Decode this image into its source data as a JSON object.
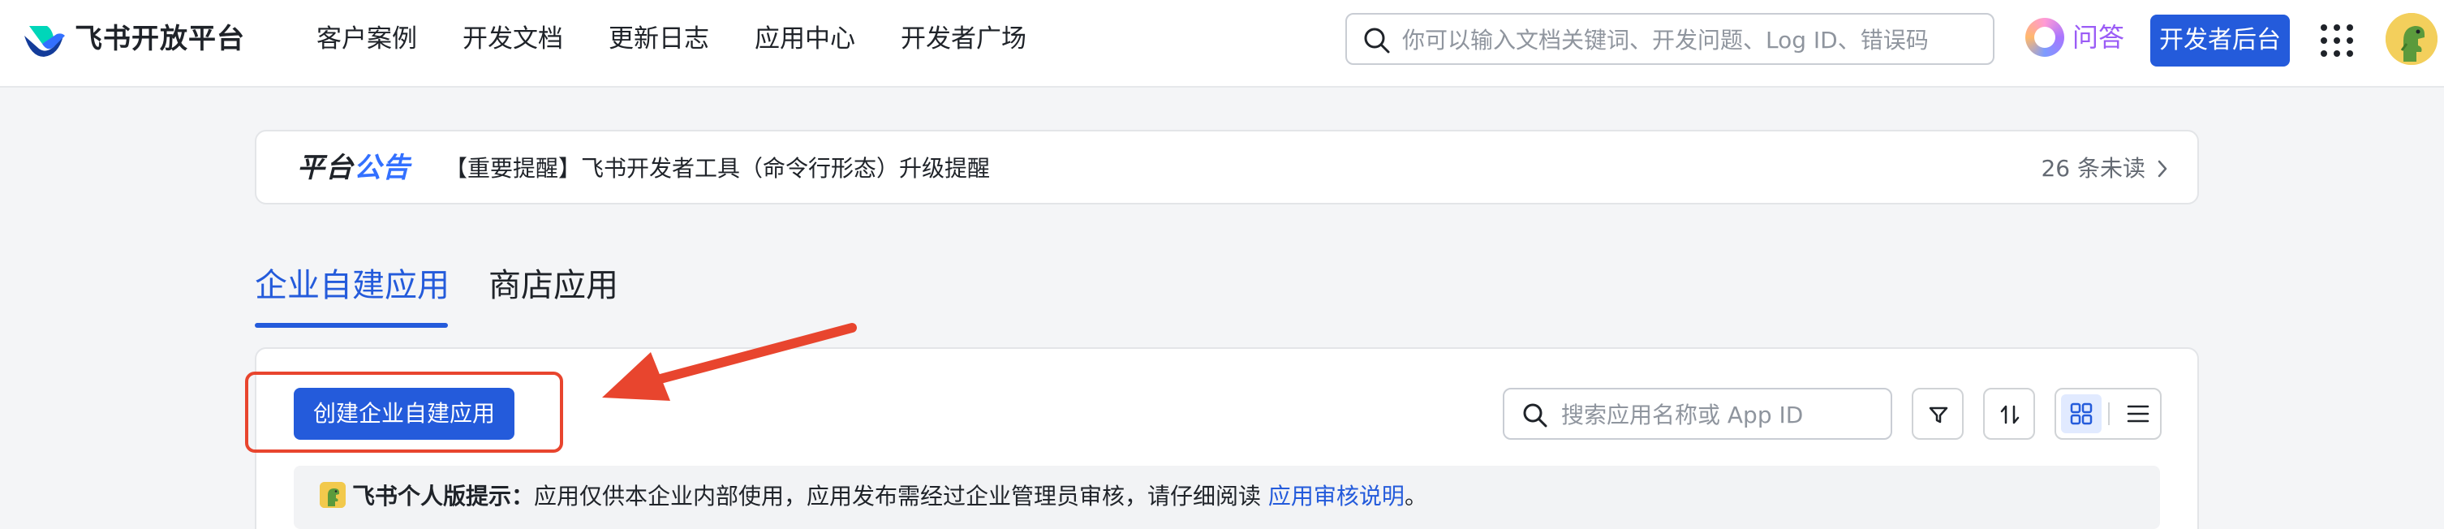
{
  "nav": {
    "brand": "飞书开放平台",
    "links": [
      "客户案例",
      "开发文档",
      "更新日志",
      "应用中心",
      "开发者广场"
    ],
    "search_placeholder": "你可以输入文档关键词、开发问题、Log ID、错误码",
    "ask_label": "问答",
    "dev_console_label": "开发者后台",
    "accent": "#245bdb"
  },
  "announcement": {
    "title_part1": "平台",
    "title_part2": "公告",
    "text": "【重要提醒】飞书开发者工具（命令行形态）升级提醒",
    "unread": "26 条未读"
  },
  "tabs": [
    {
      "label": "企业自建应用",
      "active": true
    },
    {
      "label": "商店应用",
      "active": false
    }
  ],
  "toolbar": {
    "create_label": "创建企业自建应用",
    "search_placeholder": "搜索应用名称或 App ID",
    "filter_icon": "filter-icon",
    "sort_icon": "sort-icon",
    "view_modes": [
      "grid-view-icon",
      "list-view-icon"
    ],
    "active_view": "grid"
  },
  "tip": {
    "bold": "飞书个人版提示：",
    "text": "应用仅供本企业内部使用，应用发布需经过企业管理员审核，请仔细阅读 ",
    "link": "应用审核说明",
    "end": "。"
  },
  "annotation": {
    "box_color": "#e8452e",
    "arrow_color": "#e8452e"
  }
}
